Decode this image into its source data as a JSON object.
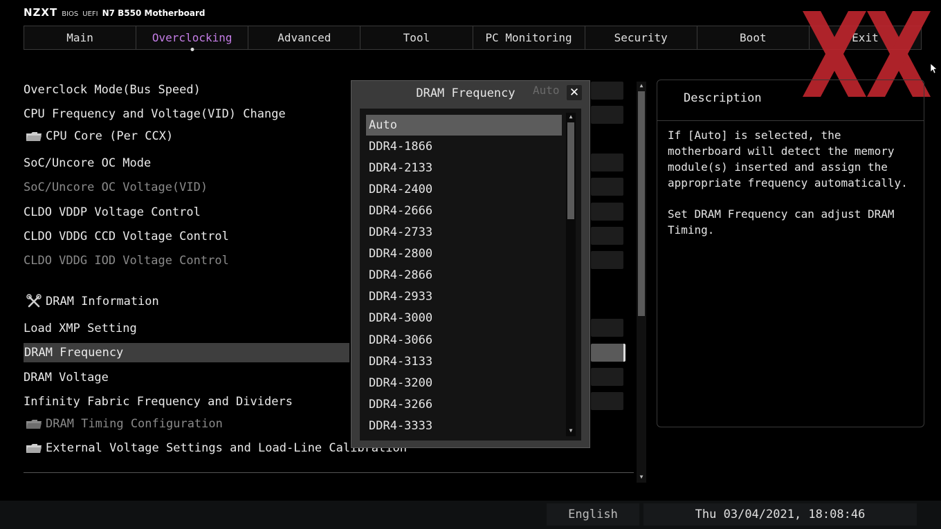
{
  "header": {
    "logo": "NZXT",
    "bios_label": "BIOS",
    "uefi_label": "UEFI",
    "model": "N7 B550 Motherboard"
  },
  "tabs": [
    {
      "label": "Main"
    },
    {
      "label": "Overclocking",
      "active": true
    },
    {
      "label": "Advanced"
    },
    {
      "label": "Tool"
    },
    {
      "label": "PC Monitoring"
    },
    {
      "label": "Security"
    },
    {
      "label": "Boot"
    },
    {
      "label": "Exit"
    }
  ],
  "settings": {
    "items": [
      {
        "label": "Overclock Mode(Bus Speed)"
      },
      {
        "label": "CPU Frequency and Voltage(VID) Change"
      },
      {
        "label": "CPU Core (Per CCX)",
        "icon": "folder-icon"
      },
      {
        "label": "SoC/Uncore OC Mode"
      },
      {
        "label": "SoC/Uncore OC Voltage(VID)",
        "disabled": true
      },
      {
        "label": "CLDO VDDP Voltage Control"
      },
      {
        "label": "CLDO VDDG CCD Voltage Control"
      },
      {
        "label": "CLDO VDDG IOD Voltage Control",
        "disabled": true
      },
      {
        "label": "DRAM Information",
        "icon": "tools-icon"
      },
      {
        "label": "Load XMP Setting"
      },
      {
        "label": "DRAM Frequency",
        "selected": true
      },
      {
        "label": "DRAM Voltage"
      },
      {
        "label": "Infinity Fabric Frequency and Dividers"
      },
      {
        "label": "DRAM Timing Configuration",
        "icon": "folder-icon",
        "disabled": true
      },
      {
        "label": "External Voltage Settings and Load-Line Calibration",
        "icon": "folder-icon"
      }
    ]
  },
  "popup": {
    "title": "DRAM Frequency",
    "current_value": "Auto",
    "close_symbol": "✕",
    "options": [
      "Auto",
      "DDR4-1866",
      "DDR4-2133",
      "DDR4-2400",
      "DDR4-2666",
      "DDR4-2733",
      "DDR4-2800",
      "DDR4-2866",
      "DDR4-2933",
      "DDR4-3000",
      "DDR4-3066",
      "DDR4-3133",
      "DDR4-3200",
      "DDR4-3266",
      "DDR4-3333"
    ],
    "selected_index": 0
  },
  "description": {
    "title": "Description",
    "paragraphs": [
      "If [Auto] is selected, the motherboard will detect the memory module(s) inserted and assign the appropriate frequency automatically.",
      "Set DRAM Frequency can adjust DRAM Timing."
    ]
  },
  "footer": {
    "language": "English",
    "datetime": "Thu 03/04/2021, 18:08:46"
  },
  "colors": {
    "accent": "#c47de6",
    "watermark": "#c0262e",
    "selected_row": "#3e3e3e"
  }
}
